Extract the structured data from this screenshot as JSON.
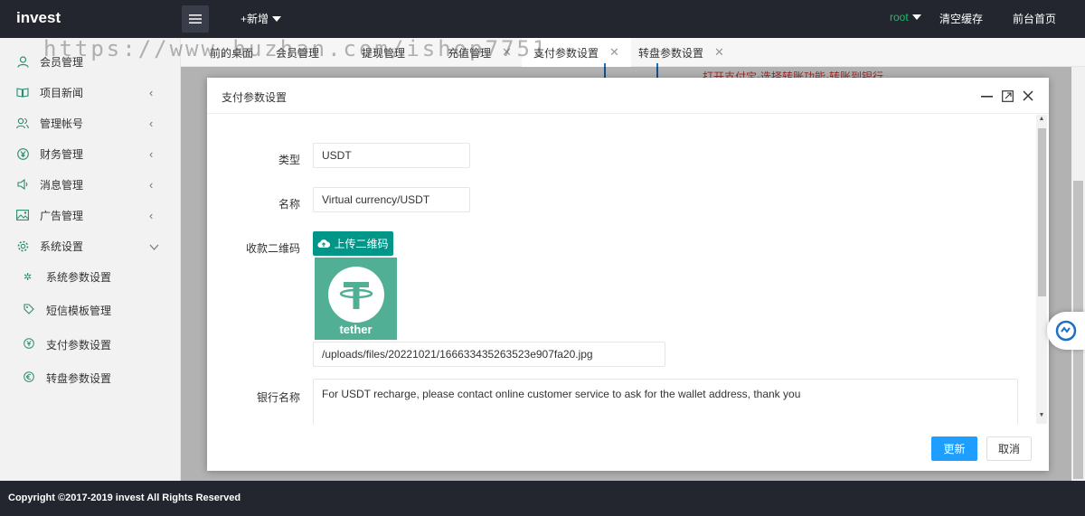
{
  "header": {
    "logo": "invest",
    "add_label": "+新增",
    "user": "root",
    "clear_cache": "清空缓存",
    "front_home": "前台首页"
  },
  "sidebar": {
    "items": [
      {
        "label": "会员管理",
        "icon": "user-icon"
      },
      {
        "label": "项目新闻",
        "icon": "book-icon"
      },
      {
        "label": "管理帐号",
        "icon": "users-icon"
      },
      {
        "label": "财务管理",
        "icon": "yen-icon"
      },
      {
        "label": "消息管理",
        "icon": "speaker-icon"
      },
      {
        "label": "广告管理",
        "icon": "image-icon"
      },
      {
        "label": "系统设置",
        "icon": "gear-icon"
      }
    ],
    "sub_items": [
      {
        "label": "系统参数设置",
        "icon": "gear-icon"
      },
      {
        "label": "短信模板管理",
        "icon": "tag-icon"
      },
      {
        "label": "支付参数设置",
        "icon": "yen-icon"
      },
      {
        "label": "转盘参数设置",
        "icon": "euro-icon"
      }
    ]
  },
  "tabs": [
    {
      "label": "前的桌面"
    },
    {
      "label": "会员管理"
    },
    {
      "label": "提现管理"
    },
    {
      "label": "充值管理"
    },
    {
      "label": "支付参数设置"
    },
    {
      "label": "转盘参数设置"
    }
  ],
  "background": {
    "red_text": "打开支付宝-选择转账功能-转账到银行"
  },
  "modal": {
    "title": "支付参数设置",
    "fields": {
      "type_label": "类型",
      "type_value": "USDT",
      "name_label": "名称",
      "name_value": "Virtual currency/USDT",
      "qr_label": "收款二维码",
      "upload_label": "上传二维码",
      "qr_caption": "tether",
      "qr_path": "/uploads/files/20221021/166633435263523e907fa20.jpg",
      "bank_label": "银行名称",
      "bank_value": "For USDT recharge, please contact online customer service to ask for the wallet address, thank you"
    },
    "update_label": "更新",
    "cancel_label": "取消"
  },
  "footer": {
    "copyright": "Copyright ©2017-2019 invest All Rights Reserved"
  },
  "watermark": "https://www.huzhan.com/ishop7751",
  "colors": {
    "header_bg": "#23262e",
    "accent_green": "#009688",
    "primary_blue": "#1e9fff",
    "tether_green": "#50af95",
    "user_green": "#19be6b"
  }
}
